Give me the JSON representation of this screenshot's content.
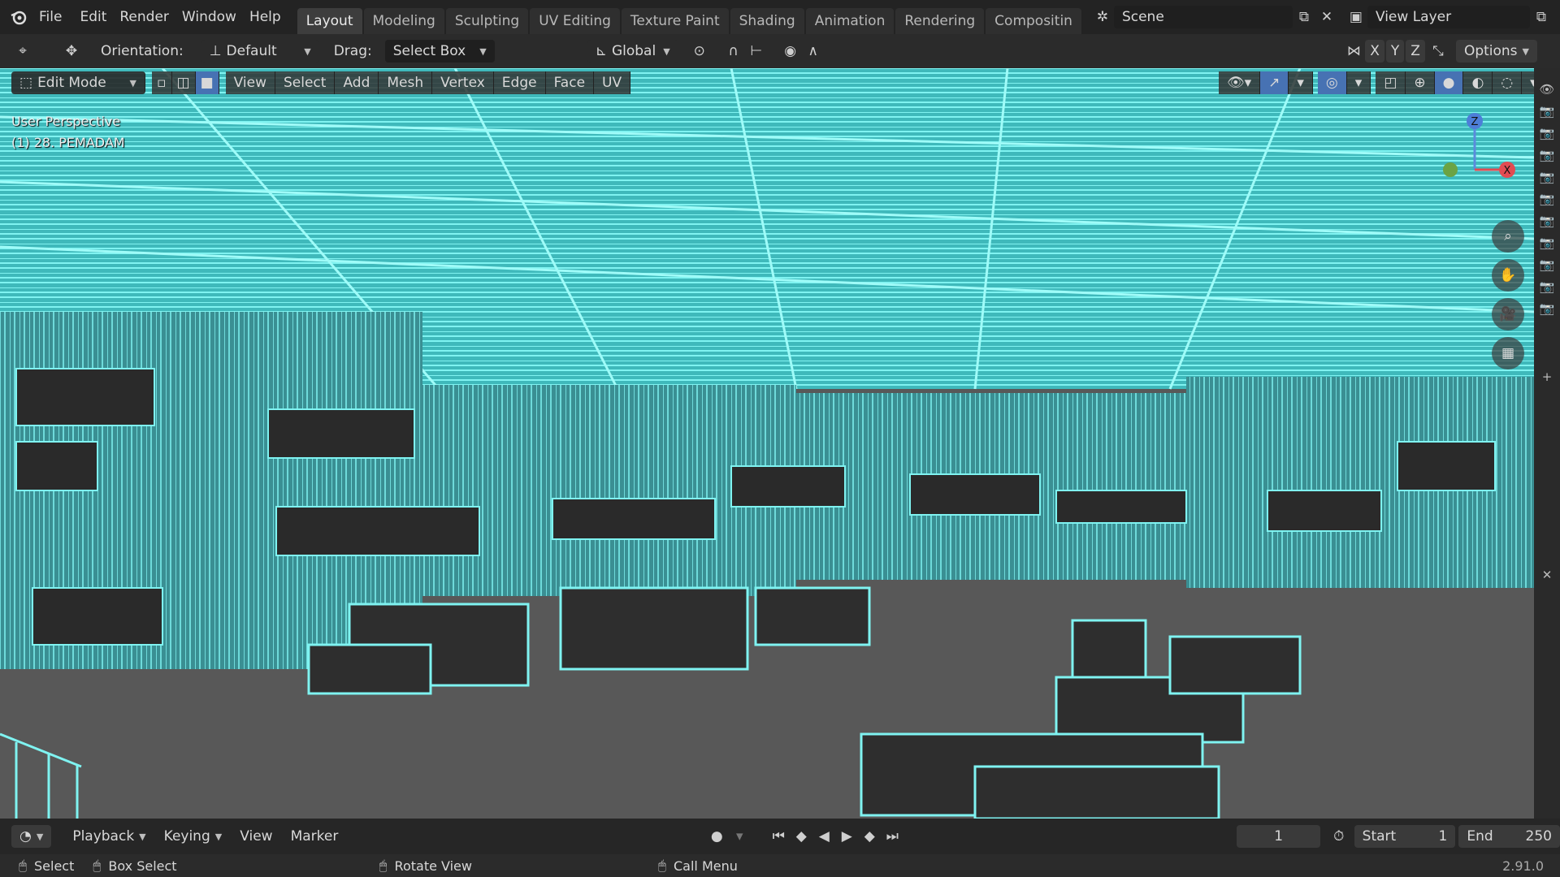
{
  "topbar": {
    "menus": [
      "File",
      "Edit",
      "Render",
      "Window",
      "Help"
    ],
    "tabs": [
      "Layout",
      "Modeling",
      "Sculpting",
      "UV Editing",
      "Texture Paint",
      "Shading",
      "Animation",
      "Rendering",
      "Compositin"
    ],
    "active_tab": "Layout",
    "scene": "Scene",
    "view_layer": "View Layer"
  },
  "toolbar": {
    "orientation_label": "Orientation:",
    "orientation_value": "Default",
    "drag_label": "Drag:",
    "drag_value": "Select Box",
    "transform_value": "Global",
    "axis_x": "X",
    "axis_y": "Y",
    "axis_z": "Z",
    "options": "Options"
  },
  "viewport": {
    "mode": "Edit Mode",
    "menus": [
      "View",
      "Select",
      "Add",
      "Mesh",
      "Vertex",
      "Edge",
      "Face",
      "UV"
    ],
    "perspective": "User Perspective",
    "object": "(1) 28. PEMADAM",
    "gizmo": {
      "z": "Z",
      "x": "X"
    },
    "wire_color": "#5ee6e6",
    "floor_color": "#585858"
  },
  "timeline": {
    "menus": [
      "Playback",
      "Keying",
      "View",
      "Marker"
    ],
    "current_frame": "1",
    "start_label": "Start",
    "start_value": "1",
    "end_label": "End",
    "end_value": "250"
  },
  "statusbar": {
    "select": "Select",
    "box_select": "Box Select",
    "rotate_view": "Rotate View",
    "call_menu": "Call Menu",
    "version": "2.91.0"
  }
}
